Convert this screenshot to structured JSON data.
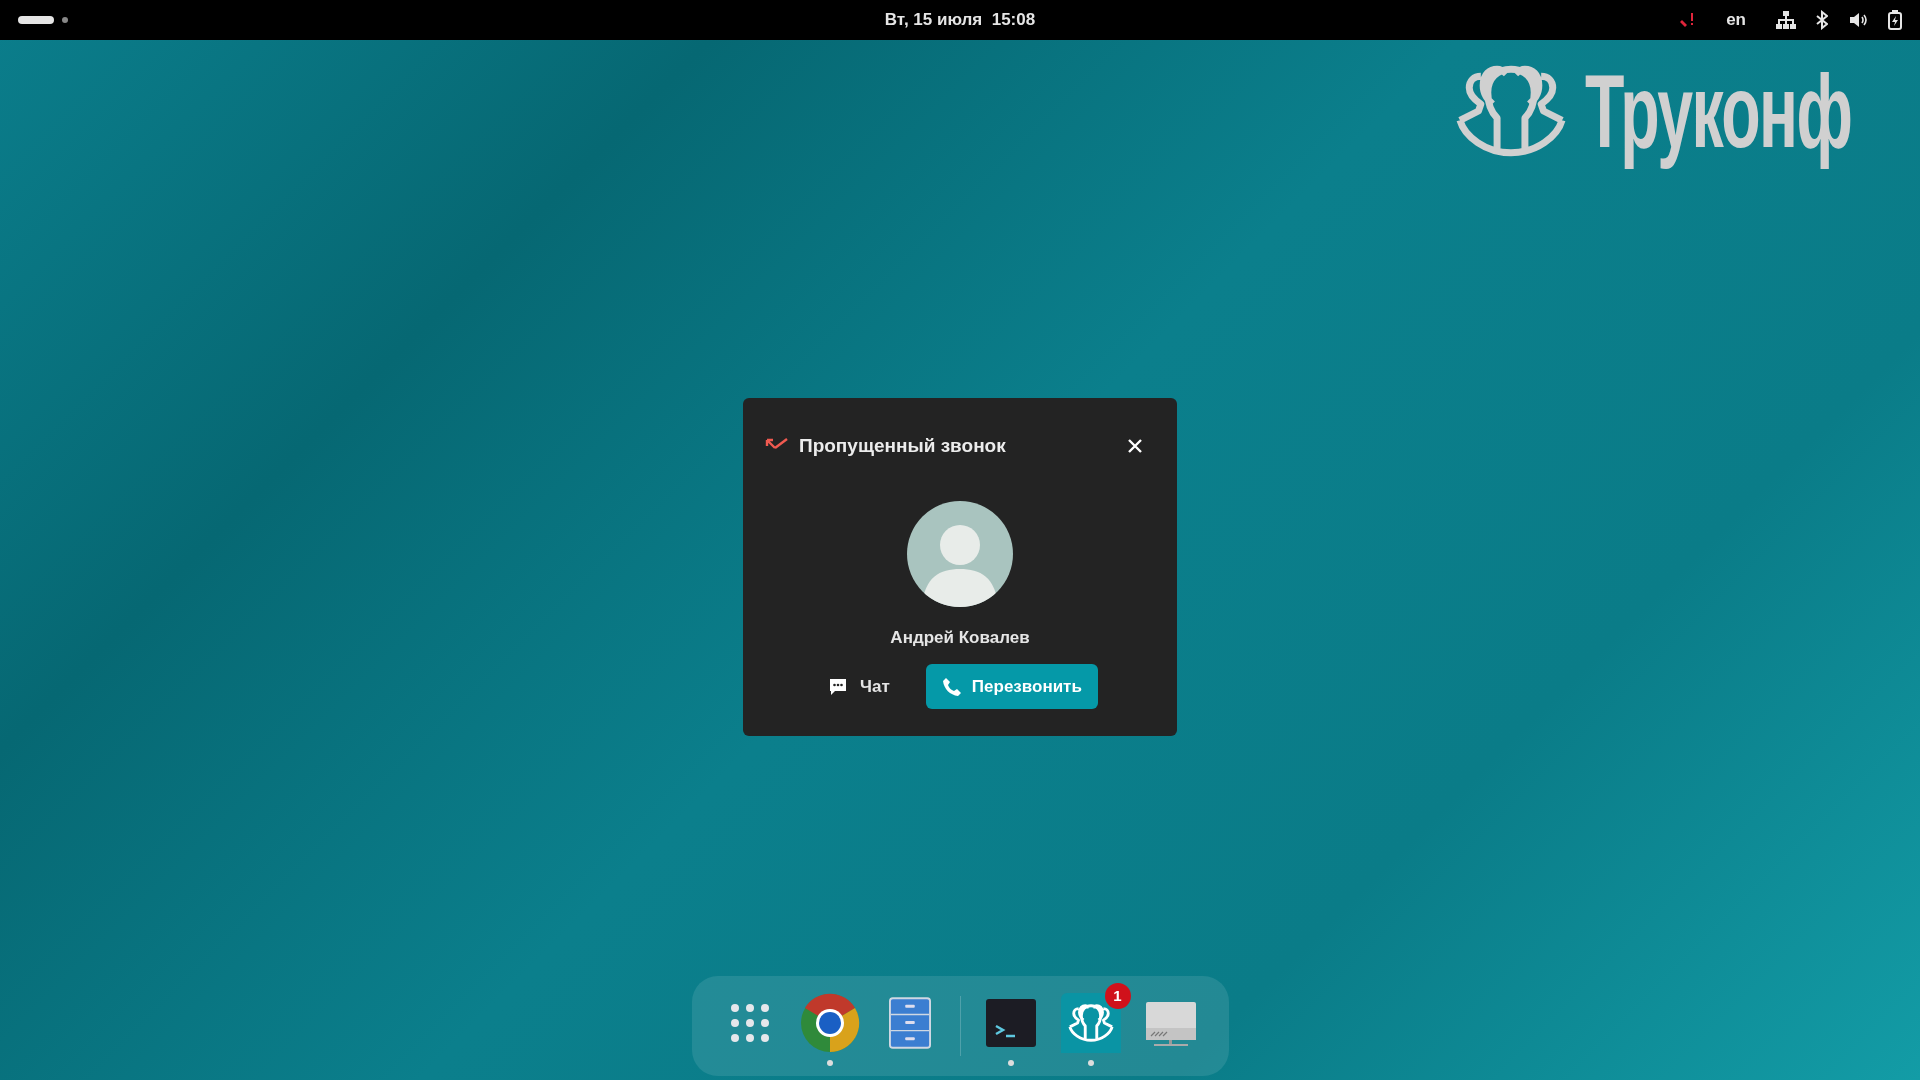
{
  "top_bar": {
    "clock": "Вт, 15 июля  15:08",
    "keyboard_layout": "en"
  },
  "logo": {
    "text": "Труконф"
  },
  "notification": {
    "title": "Пропущенный звонок",
    "contact_name": "Андрей Ковалев",
    "buttons": [
      {
        "label": "Чат",
        "kind": "chat",
        "primary": false
      },
      {
        "label": "Перезвонить",
        "kind": "call",
        "primary": true
      }
    ]
  },
  "dock": {
    "items": [
      {
        "kind": "apps",
        "running": false
      },
      {
        "kind": "browser",
        "running": true
      },
      {
        "kind": "files",
        "running": false
      },
      {
        "kind": "separator"
      },
      {
        "kind": "terminal",
        "running": true
      },
      {
        "kind": "truconf",
        "running": true,
        "badge": "1"
      },
      {
        "kind": "monitor",
        "running": false
      }
    ]
  }
}
